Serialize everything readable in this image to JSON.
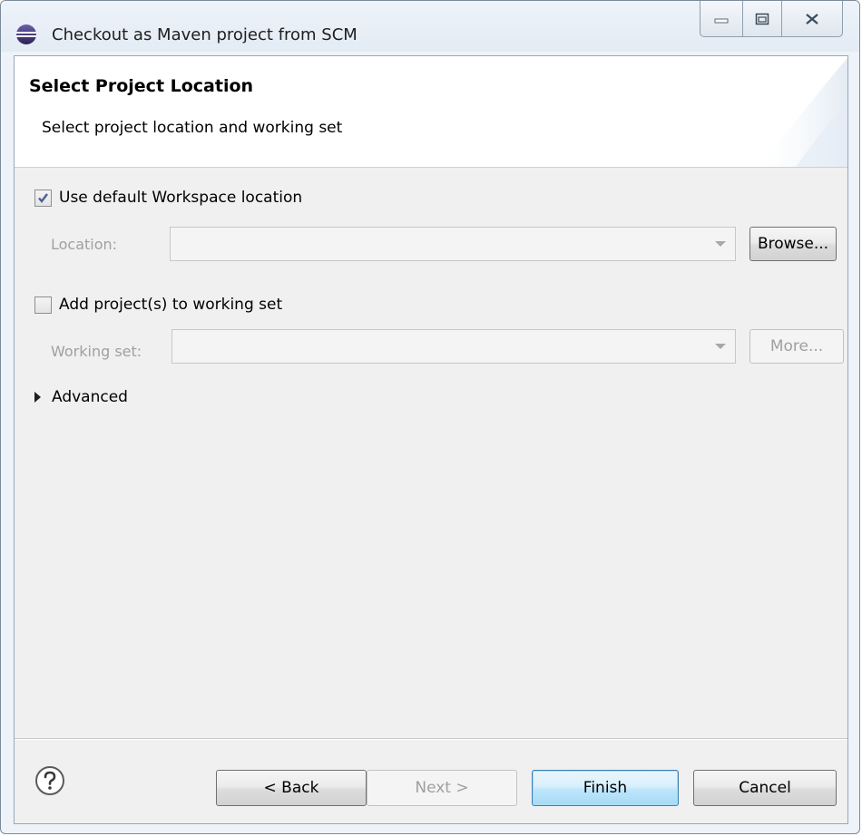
{
  "window": {
    "title": "Checkout as Maven project from SCM",
    "icon": "eclipse-icon",
    "controls": [
      "minimize-icon",
      "maximize-icon",
      "close-icon"
    ]
  },
  "header": {
    "title": "Select Project Location",
    "description": "Select project location and working set"
  },
  "form": {
    "use_default_location": {
      "label": "Use default Workspace location",
      "checked": true
    },
    "location": {
      "label": "Location:",
      "value": "",
      "enabled": false
    },
    "browse_label": "Browse...",
    "add_to_working_set": {
      "label": "Add project(s) to working set",
      "checked": false
    },
    "working_set": {
      "label": "Working set:",
      "value": "",
      "enabled": false
    },
    "more_label": "More...",
    "advanced_label": "Advanced"
  },
  "footer": {
    "help_icon": "help-icon",
    "back_label": "< Back",
    "next_label": "Next >",
    "finish_label": "Finish",
    "cancel_label": "Cancel"
  }
}
